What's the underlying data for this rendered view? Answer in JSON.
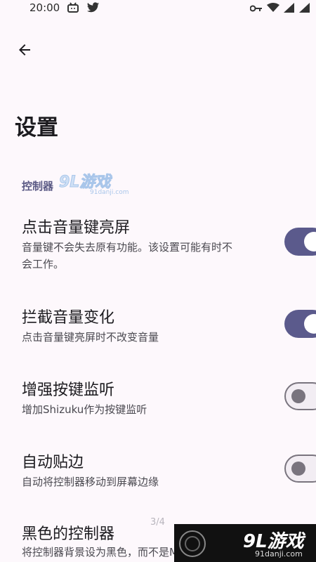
{
  "status_bar": {
    "time": "20:00"
  },
  "header": {
    "title": "设置"
  },
  "section": {
    "label": "控制器"
  },
  "watermark": {
    "logo_text": "9L游戏",
    "url": "91danji.com"
  },
  "settings": [
    {
      "title": "点击音量键亮屏",
      "desc": "音量键不会失去原有功能。该设置可能有时不会工作。",
      "desc_line1": "音量键不会失去原有功能。该设置可能有时不",
      "desc_line2": "会工作。",
      "enabled": true
    },
    {
      "title": "拦截音量变化",
      "desc": "点击音量键亮屏时不改变音量",
      "enabled": true
    },
    {
      "title": "增强按键监听",
      "desc": "增加Shizuku作为按键监听",
      "enabled": false
    },
    {
      "title": "自动贴边",
      "desc": "自动将控制器移动到屏幕边缘",
      "enabled": false
    },
    {
      "title": "黑色的控制器",
      "desc": "将控制器背景设为黑色，而不是Mo",
      "enabled": null
    }
  ],
  "page_indicator": "3/4",
  "colors": {
    "accent": "#5b5a8c",
    "background": "#fdf8fc",
    "section": "#5b5a85"
  }
}
